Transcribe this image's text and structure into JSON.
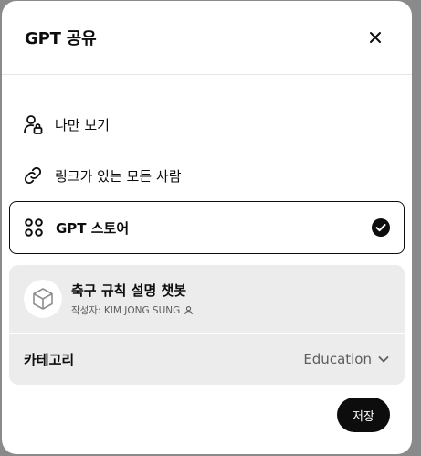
{
  "dialog": {
    "title": "GPT 공유",
    "close_icon": "close-icon"
  },
  "options": [
    {
      "label": "나만 보기",
      "icon": "person-lock-icon",
      "selected": false
    },
    {
      "label": "링크가 있는 모든 사람",
      "icon": "link-icon",
      "selected": false
    },
    {
      "label": "GPT 스토어",
      "icon": "grid-circles-icon",
      "selected": true
    }
  ],
  "gpt": {
    "name": "축구 규칙 설명 챗봇",
    "author": "작성자: KIM JONG SUNG",
    "icon": "cube-icon"
  },
  "category": {
    "label": "카테고리",
    "value": "Education"
  },
  "save_label": "저장",
  "colors": {
    "accent": "#0d0d0d",
    "card_bg": "#ececec",
    "backdrop": "#8a8a8a"
  }
}
